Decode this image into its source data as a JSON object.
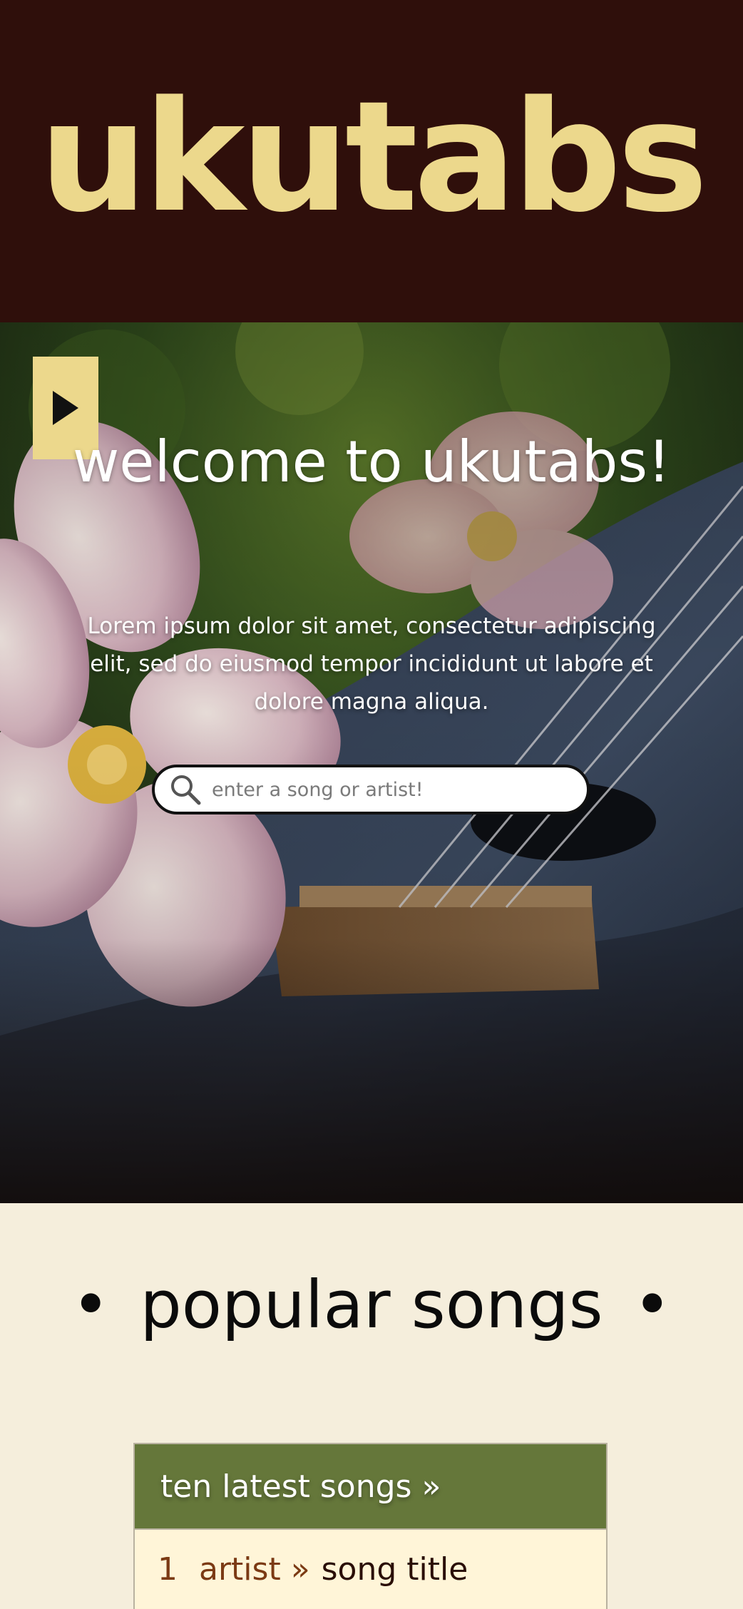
{
  "header": {
    "logo_text": "ukutabs"
  },
  "hero": {
    "title": "welcome to ukutabs!",
    "intro": "Lorem ipsum dolor sit amet, consectetur adipiscing elit, sed do eiusmod tempor incididunt ut labore et dolore magna aliqua.",
    "menu_icon": "play-triangle-icon"
  },
  "search": {
    "placeholder": "enter a song or artist!",
    "value": "",
    "icon": "search-icon"
  },
  "popular": {
    "bullet_left": "•",
    "title": "popular songs",
    "bullet_right": "•"
  },
  "latest": {
    "header_label": "ten latest songs »",
    "rows": [
      {
        "rank": "1",
        "artist": "artist »",
        "title": "song title"
      }
    ]
  },
  "colors": {
    "header_bg": "#2f0f0b",
    "logo": "#ecd88c",
    "page_bg": "#f5eedc",
    "panel_header": "#65773a",
    "artist_link": "#7b3a14"
  }
}
